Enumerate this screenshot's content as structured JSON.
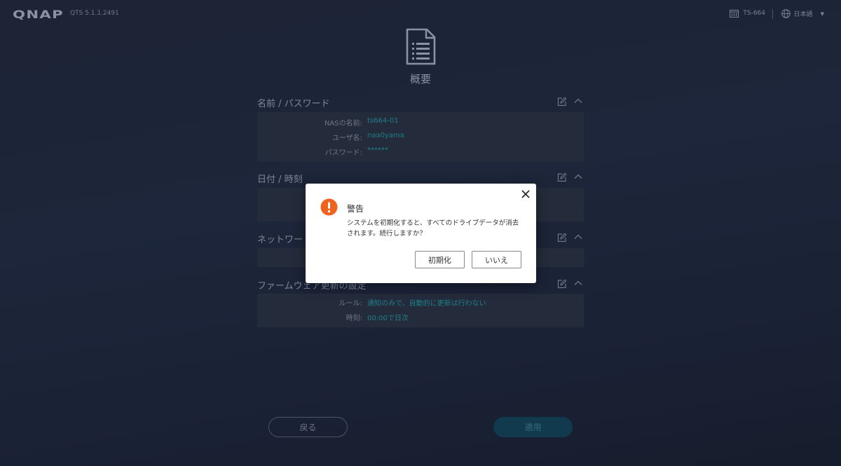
{
  "topbar": {
    "logo_text": "QNAP",
    "version": "QTS 5.1.1.2491",
    "model": "TS-664",
    "language": "日本語"
  },
  "page": {
    "title": "概要"
  },
  "sections": [
    {
      "title": "名前 / パスワード",
      "rows": [
        {
          "label": "NASの名前:",
          "value": "ts664-01"
        },
        {
          "label": "ユーザ名:",
          "value": "naa0yama"
        },
        {
          "label": "パスワード:",
          "value": "******"
        }
      ]
    },
    {
      "title": "日付 / 時刻",
      "rows": []
    },
    {
      "title": "ネットワー",
      "rows": []
    },
    {
      "title": "ファームウェア更新の設定",
      "rows": [
        {
          "label": "ルール:",
          "value": "通知のみで、自動的に更新は行わない"
        },
        {
          "label": "時刻:",
          "value": "00:00で日次"
        }
      ]
    }
  ],
  "footer": {
    "back_label": "戻る",
    "apply_label": "適用"
  },
  "dialog": {
    "title": "警告",
    "message": "システムを初期化すると、すべてのドライブデータが消去されます。続行しますか？",
    "confirm_label": "初期化",
    "cancel_label": "いいえ",
    "icon": "warning-icon",
    "accent_color": "#f0631e"
  },
  "colors": {
    "background": "#1d263a",
    "value_text": "#1f7d8a",
    "apply_button": "#113a4f"
  }
}
